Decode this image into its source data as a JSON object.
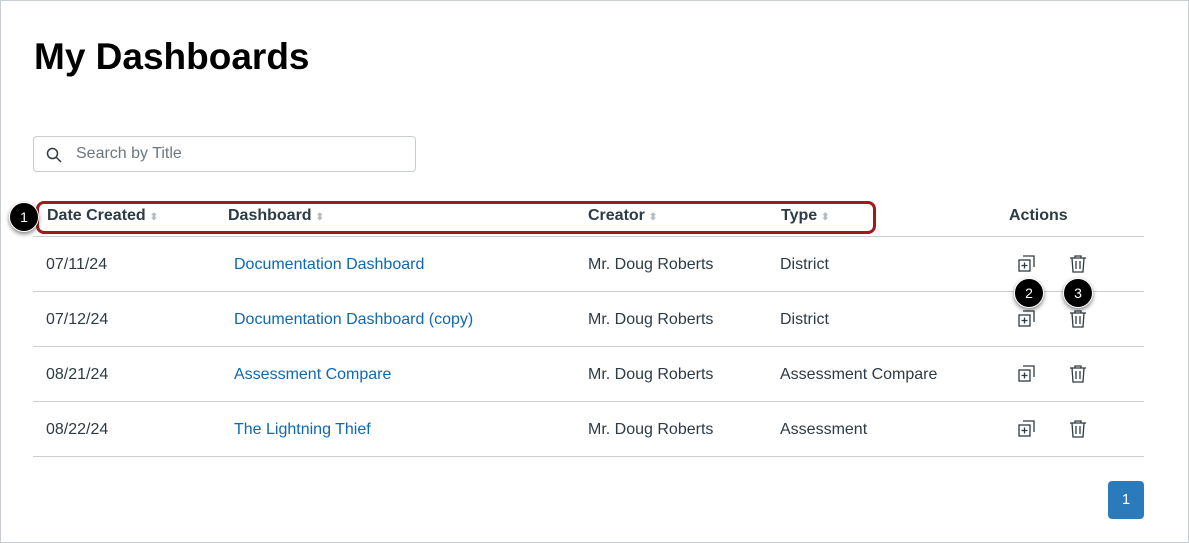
{
  "title": "My Dashboards",
  "search": {
    "placeholder": "Search by Title"
  },
  "columns": [
    "Date Created",
    "Dashboard",
    "Creator",
    "Type",
    "Actions"
  ],
  "rows": [
    {
      "date": "07/11/24",
      "dashboard": "Documentation Dashboard",
      "creator": "Mr. Doug Roberts",
      "type": "District"
    },
    {
      "date": "07/12/24",
      "dashboard": "Documentation Dashboard (copy)",
      "creator": "Mr. Doug Roberts",
      "type": "District"
    },
    {
      "date": "08/21/24",
      "dashboard": "Assessment Compare",
      "creator": "Mr. Doug Roberts",
      "type": "Assessment Compare"
    },
    {
      "date": "08/22/24",
      "dashboard": "The Lightning Thief",
      "creator": "Mr. Doug Roberts",
      "type": "Assessment"
    }
  ],
  "badges": [
    "1",
    "2",
    "3"
  ],
  "pagination": {
    "current": "1"
  },
  "colors": {
    "link": "#0e68b3",
    "highlight": "#9e1b1b",
    "page": "#2b7abc"
  }
}
